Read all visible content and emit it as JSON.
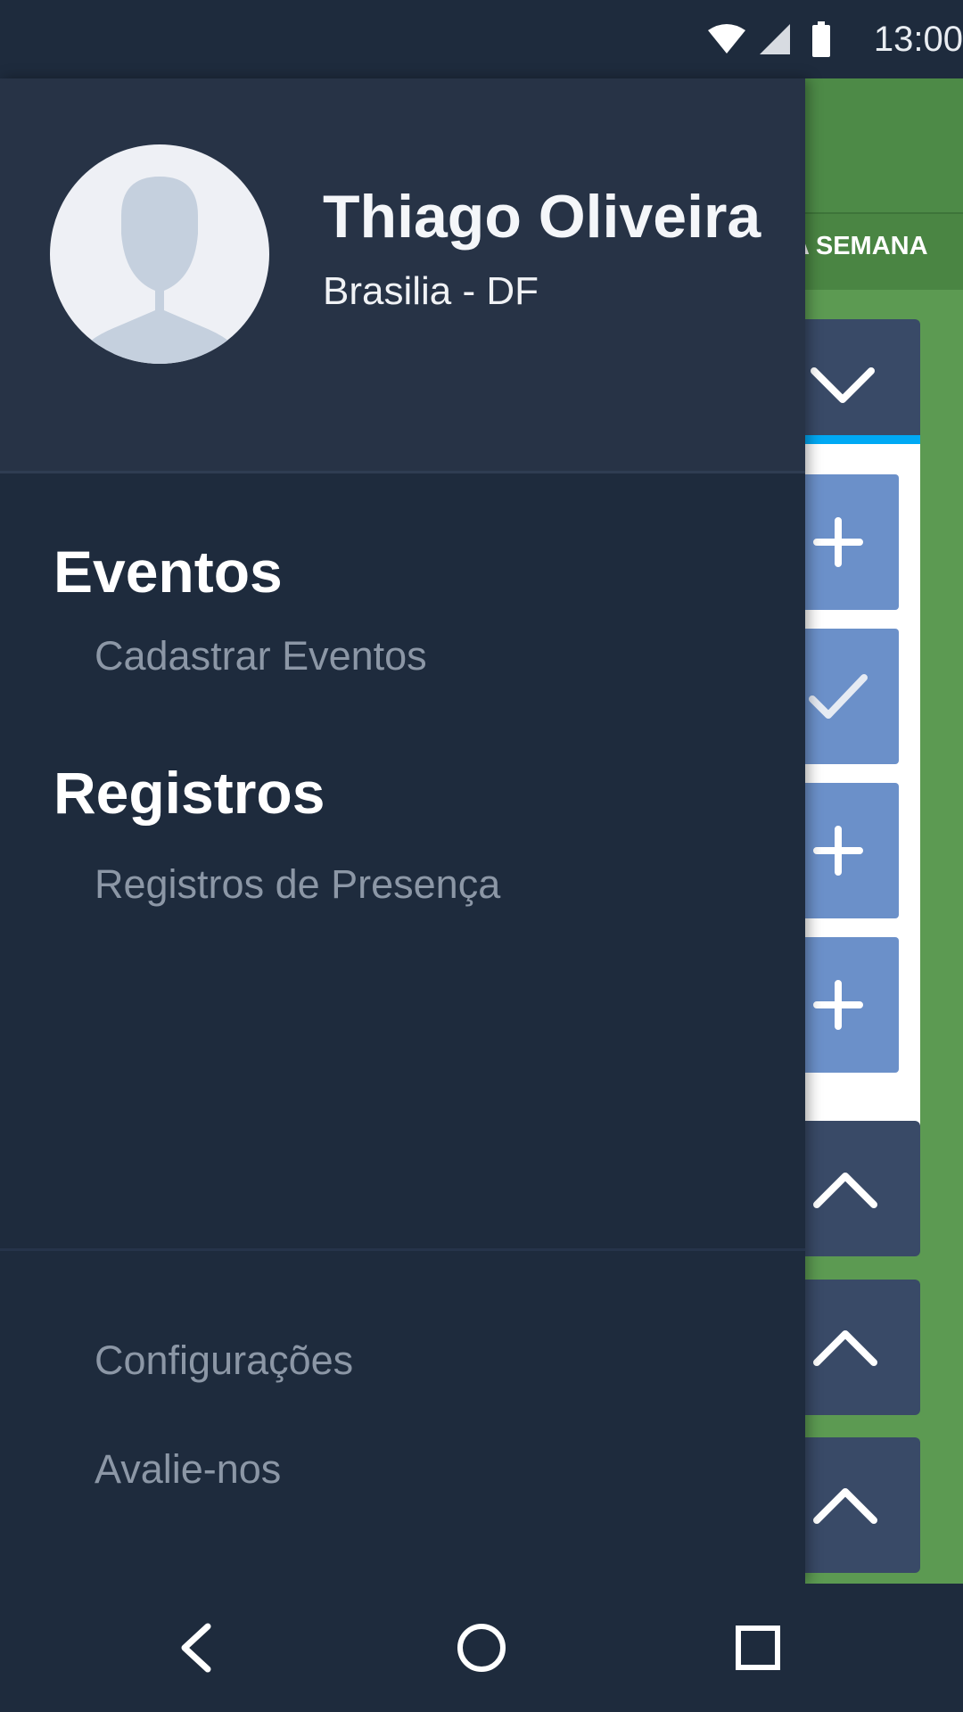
{
  "status_bar": {
    "time": "13:00",
    "icons": [
      "wifi-icon",
      "signal-icon",
      "battery-icon"
    ]
  },
  "background_app": {
    "tab_label": "DA SEMANA",
    "colors": {
      "green": "#5c9a52",
      "panel_header": "#394a67",
      "item_blue": "#6b90c9",
      "accent_line": "#00a9f4"
    },
    "item_icons": [
      "plus-icon",
      "check-icon",
      "plus-icon",
      "plus-icon"
    ],
    "card_icons": [
      "chevron-up-icon",
      "chevron-up-icon",
      "chevron-up-icon"
    ]
  },
  "drawer": {
    "user": {
      "name": "Thiago Oliveira",
      "location": "Brasilia - DF",
      "avatar_icon": "person-placeholder-icon"
    },
    "sections": [
      {
        "title": "Eventos",
        "items": [
          "Cadastrar Eventos"
        ]
      },
      {
        "title": "Registros",
        "items": [
          "Registros de Presença"
        ]
      }
    ],
    "footer_items": [
      "Configurações",
      "Avalie-nos"
    ],
    "colors": {
      "background": "#1e2b3d",
      "header": "#273346",
      "item_text": "#8c97a6"
    }
  },
  "nav_bar": {
    "buttons": [
      "back-icon",
      "home-icon",
      "recents-icon"
    ]
  }
}
